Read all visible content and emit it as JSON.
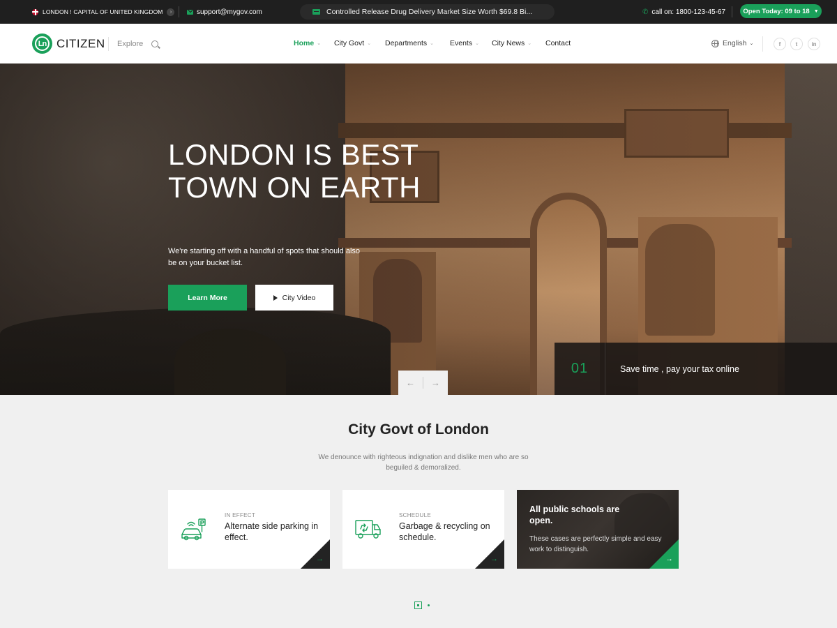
{
  "topbar": {
    "location": "LONDON ! CAPITAL OF UNITED KINGDOM",
    "email": "support@mygov.com",
    "ticker": "Controlled Release Drug Delivery Market Size Worth $69.8 Bi...",
    "phone": "call on: 1800-123-45-67",
    "open_today": "Open Today: 09 to 18"
  },
  "header": {
    "logo_mark": "Ln",
    "logo_text": "CITIZEN",
    "explore": "Explore",
    "nav": [
      "Home",
      "City Govt",
      "Departments",
      "Events",
      "City News",
      "Contact"
    ],
    "language": "English",
    "social": [
      "f",
      "t",
      "in"
    ]
  },
  "hero": {
    "title": "LONDON IS BEST TOWN ON EARTH",
    "subtitle": "We're starting off with a handful of spots that should also be on your bucket list.",
    "learn_more": "Learn More",
    "city_video": "City Video",
    "promo_number": "01",
    "promo_text": "Save time , pay your tax online"
  },
  "section": {
    "title": "City Govt of London",
    "subtitle": "We denounce with righteous indignation and dislike men who are so beguiled & demoralized."
  },
  "cards": [
    {
      "tag": "IN EFFECT",
      "title": "Alternate side parking in effect.",
      "icon": "parking-car-icon"
    },
    {
      "tag": "SCHEDULE",
      "title": "Garbage & recycling on schedule.",
      "icon": "recycling-truck-icon"
    },
    {
      "title": "All public schools are open.",
      "desc": "These cases are perfectly simple and easy work to distinguish."
    }
  ],
  "colors": {
    "accent": "#1aa05a",
    "topbar": "#1f1f1f",
    "dark": "#232323"
  }
}
